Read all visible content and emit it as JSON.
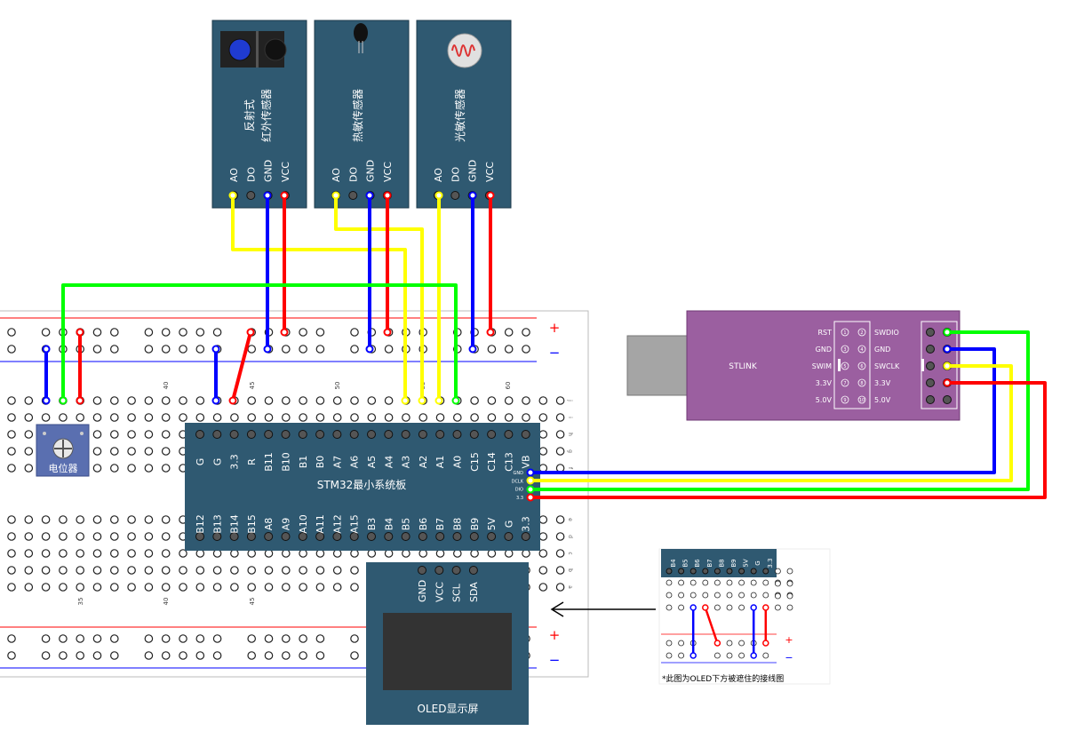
{
  "sensors": [
    {
      "name_line1": "反射式",
      "name_line2": "红外传感器",
      "pins": [
        "AO",
        "DO",
        "GND",
        "VCC"
      ],
      "icon": "ir-sensor-icon"
    },
    {
      "name_line1": "热敏传感器",
      "name_line2": "",
      "pins": [
        "AO",
        "DO",
        "GND",
        "VCC"
      ],
      "icon": "thermistor-icon"
    },
    {
      "name_line1": "光敏传感器",
      "name_line2": "",
      "pins": [
        "AO",
        "DO",
        "GND",
        "VCC"
      ],
      "icon": "photoresistor-icon"
    }
  ],
  "breadboard": {
    "col_numbers": [
      "35",
      "40",
      "45",
      "50",
      "55",
      "60"
    ],
    "row_letters_top": [
      "j",
      "i",
      "h",
      "g",
      "f"
    ],
    "row_letters_bottom": [
      "e",
      "d",
      "c",
      "b",
      "a"
    ],
    "plus": "+",
    "minus": "−"
  },
  "potentiometer": {
    "label": "电位器"
  },
  "stm32": {
    "title": "STM32最小系统板",
    "top_pins": [
      "G",
      "G",
      "3.3",
      "R",
      "B11",
      "B10",
      "B1",
      "B0",
      "A7",
      "A6",
      "A5",
      "A4",
      "A3",
      "A2",
      "A1",
      "A0",
      "C15",
      "C14",
      "C13",
      "VB"
    ],
    "bottom_pins": [
      "B12",
      "B13",
      "B14",
      "B15",
      "A8",
      "A9",
      "A10",
      "A11",
      "A12",
      "A15",
      "B3",
      "B4",
      "B5",
      "B6",
      "B7",
      "B8",
      "B9",
      "5V",
      "G",
      "3.3"
    ],
    "swd_pins": [
      "GND",
      "DCLK",
      "DIO",
      "3.3"
    ]
  },
  "stlink": {
    "label": "STLINK",
    "left_labels": [
      "RST",
      "GND",
      "SWIM",
      "3.3V",
      "5.0V"
    ],
    "right_labels": [
      "SWDIO",
      "GND",
      "SWCLK",
      "3.3V",
      "5.0V"
    ],
    "pin_numbers": [
      "1",
      "2",
      "3",
      "4",
      "5",
      "6",
      "7",
      "8",
      "9",
      "10"
    ]
  },
  "oled": {
    "label": "OLED显示屏",
    "pins": [
      "GND",
      "VCC",
      "SCL",
      "SDA"
    ]
  },
  "inset": {
    "pins": [
      "B4",
      "B5",
      "B6",
      "B7",
      "B8",
      "B9",
      "5V",
      "G",
      "3.3"
    ],
    "caption": "*此图为OLED下方被遮住的接线图",
    "plus": "+",
    "minus": "−"
  },
  "colors": {
    "module": "#2f5971",
    "stlink": "#9b5fa0",
    "breadboard": "#ffffff",
    "wire_red": "#ff0000",
    "wire_blue": "#0000ff",
    "wire_yellow": "#ffff00",
    "wire_green": "#00ff00"
  }
}
